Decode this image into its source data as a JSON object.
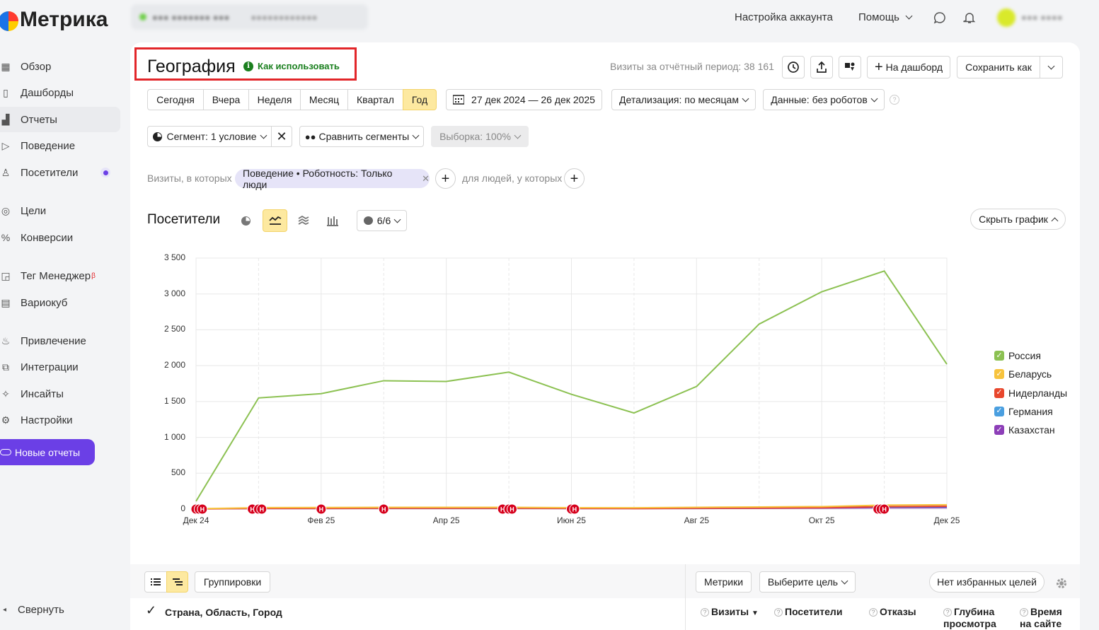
{
  "app": {
    "logo": "Метрика",
    "counter_name": "●●● ●●●●●●● ●●●",
    "counter_extra": "●●●●●●●●●●●●"
  },
  "topbar": {
    "account_settings": "Настройка аккаунта",
    "help": "Помощь",
    "user_name": "●●● ●●●●"
  },
  "sidebar": {
    "items": [
      {
        "label": "Обзор",
        "icon": "grid-icon"
      },
      {
        "label": "Дашборды",
        "icon": "dashboard-icon"
      },
      {
        "label": "Отчеты",
        "icon": "bar-chart-icon",
        "active": true
      },
      {
        "label": "Поведение",
        "icon": "play-icon"
      },
      {
        "label": "Посетители",
        "icon": "person-icon"
      },
      {
        "label": "Цели",
        "icon": "target-icon"
      },
      {
        "label": "Конверсии",
        "icon": "percent-icon"
      },
      {
        "label": "Тег Менеджер",
        "icon": "tag-icon",
        "badge": "β"
      },
      {
        "label": "Вариокуб",
        "icon": "cube-icon"
      },
      {
        "label": "Привлечение",
        "icon": "flame-icon"
      },
      {
        "label": "Интеграции",
        "icon": "puzzle-icon"
      },
      {
        "label": "Инсайты",
        "icon": "sparkle-icon"
      },
      {
        "label": "Настройки",
        "icon": "gear-icon"
      }
    ],
    "new_reports": "Новые отчеты",
    "collapse": "Свернуть"
  },
  "report": {
    "title": "География",
    "howto": "Как использовать",
    "visits_summary": "Визиты за отчётный период: 38 161",
    "to_dashboard": "На дашборд",
    "save_as": "Сохранить как"
  },
  "periods": [
    "Сегодня",
    "Вчера",
    "Неделя",
    "Месяц",
    "Квартал",
    "Год"
  ],
  "active_period": "Год",
  "date_range": "27 дек 2024 — 26 дек 2025",
  "detail": "Детализация: по месяцам",
  "data_filter": "Данные: без роботов",
  "segment": {
    "label": "Сегмент: 1 условие",
    "compare": "Сравнить сегменты",
    "sample": "Выборка: 100%"
  },
  "filter": {
    "prefix": "Визиты, в которых",
    "chip": "Поведение • Роботность: Только люди",
    "people": "для людей, у которых"
  },
  "graph": {
    "title": "Посетители",
    "series_count": "6/6",
    "hide": "Скрыть график"
  },
  "colors": {
    "accent": "#fde9a0",
    "purple": "#6b3fe6",
    "russia": "#8cc152",
    "belarus": "#f7c33d",
    "netherlands": "#e8472d",
    "germany": "#4a9fe0",
    "kazakhstan": "#8d3fb8",
    "marker": "#d6001c"
  },
  "chart_data": {
    "type": "line",
    "x": [
      "Дек 24",
      "Янв 25",
      "Фев 25",
      "Мар 25",
      "Апр 25",
      "Май 25",
      "Июн 25",
      "Июл 25",
      "Авг 25",
      "Сен 25",
      "Окт 25",
      "Ноя 25",
      "Дек 25"
    ],
    "xticks": [
      "Дек 24",
      "Фев 25",
      "Апр 25",
      "Июн 25",
      "Авг 25",
      "Окт 25",
      "Дек 25"
    ],
    "yticks": [
      "0",
      "500",
      "1 000",
      "1 500",
      "2 000",
      "2 500",
      "3 000",
      "3 500"
    ],
    "ylim": [
      0,
      3500
    ],
    "grid": true,
    "legend_position": "right",
    "series": [
      {
        "name": "Россия",
        "color": "#8cc152",
        "values": [
          110,
          1550,
          1610,
          1790,
          1780,
          1910,
          1600,
          1340,
          1710,
          2580,
          3030,
          3320,
          2020
        ]
      },
      {
        "name": "Беларусь",
        "color": "#f7c33d",
        "values": [
          5,
          20,
          22,
          25,
          25,
          25,
          20,
          18,
          25,
          30,
          35,
          55,
          60
        ]
      },
      {
        "name": "Нидерланды",
        "color": "#e8472d",
        "values": [
          3,
          10,
          10,
          12,
          12,
          12,
          10,
          8,
          12,
          15,
          20,
          35,
          40
        ]
      },
      {
        "name": "Германия",
        "color": "#4a9fe0",
        "values": [
          3,
          12,
          12,
          14,
          14,
          14,
          12,
          10,
          14,
          18,
          30,
          30,
          35
        ]
      },
      {
        "name": "Казахстан",
        "color": "#8d3fb8",
        "values": [
          2,
          8,
          8,
          9,
          9,
          9,
          8,
          7,
          9,
          11,
          14,
          18,
          20
        ]
      }
    ],
    "annotations": {
      "label": "Н",
      "positions": [
        0,
        0.05,
        0.1,
        0.9,
        1,
        1.05,
        2,
        3,
        4.9,
        5,
        5.05,
        6,
        6.05,
        10.9,
        10.95,
        11
      ]
    }
  },
  "table": {
    "groupings": "Группировки",
    "metrics": "Метрики",
    "goal": "Выберите цель",
    "fav_goals": "Нет избранных целей",
    "dimension": "Страна, Область, Город",
    "columns": [
      {
        "label": "Визиты",
        "sort": "▼"
      },
      {
        "label": "Посетители"
      },
      {
        "label": "Отказы"
      },
      {
        "label": "Глубина просмотра"
      },
      {
        "label": "Время на сайте"
      }
    ]
  }
}
